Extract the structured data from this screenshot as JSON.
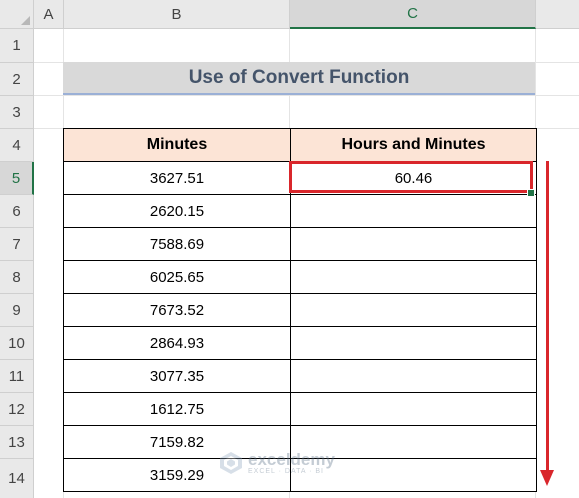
{
  "columns": [
    "A",
    "B",
    "C"
  ],
  "rows": [
    "1",
    "2",
    "3",
    "4",
    "5",
    "6",
    "7",
    "8",
    "9",
    "10",
    "11",
    "12",
    "13",
    "14"
  ],
  "title": "Use of Convert Function",
  "table": {
    "headers": [
      "Minutes",
      "Hours and Minutes"
    ],
    "rows": [
      [
        "3627.51",
        "60.46"
      ],
      [
        "2620.15",
        ""
      ],
      [
        "7588.69",
        ""
      ],
      [
        "6025.65",
        ""
      ],
      [
        "7673.52",
        ""
      ],
      [
        "2864.93",
        ""
      ],
      [
        "3077.35",
        ""
      ],
      [
        "1612.75",
        ""
      ],
      [
        "7159.82",
        ""
      ],
      [
        "3159.29",
        ""
      ]
    ]
  },
  "watermark": {
    "name": "exceldemy",
    "tagline": "EXCEL · DATA · BI"
  },
  "colors": {
    "header_fill": "#fce4d6",
    "title_fill": "#d9d9d9",
    "title_text": "#44546a",
    "highlight_red": "#d9262b",
    "excel_green": "#217346"
  }
}
